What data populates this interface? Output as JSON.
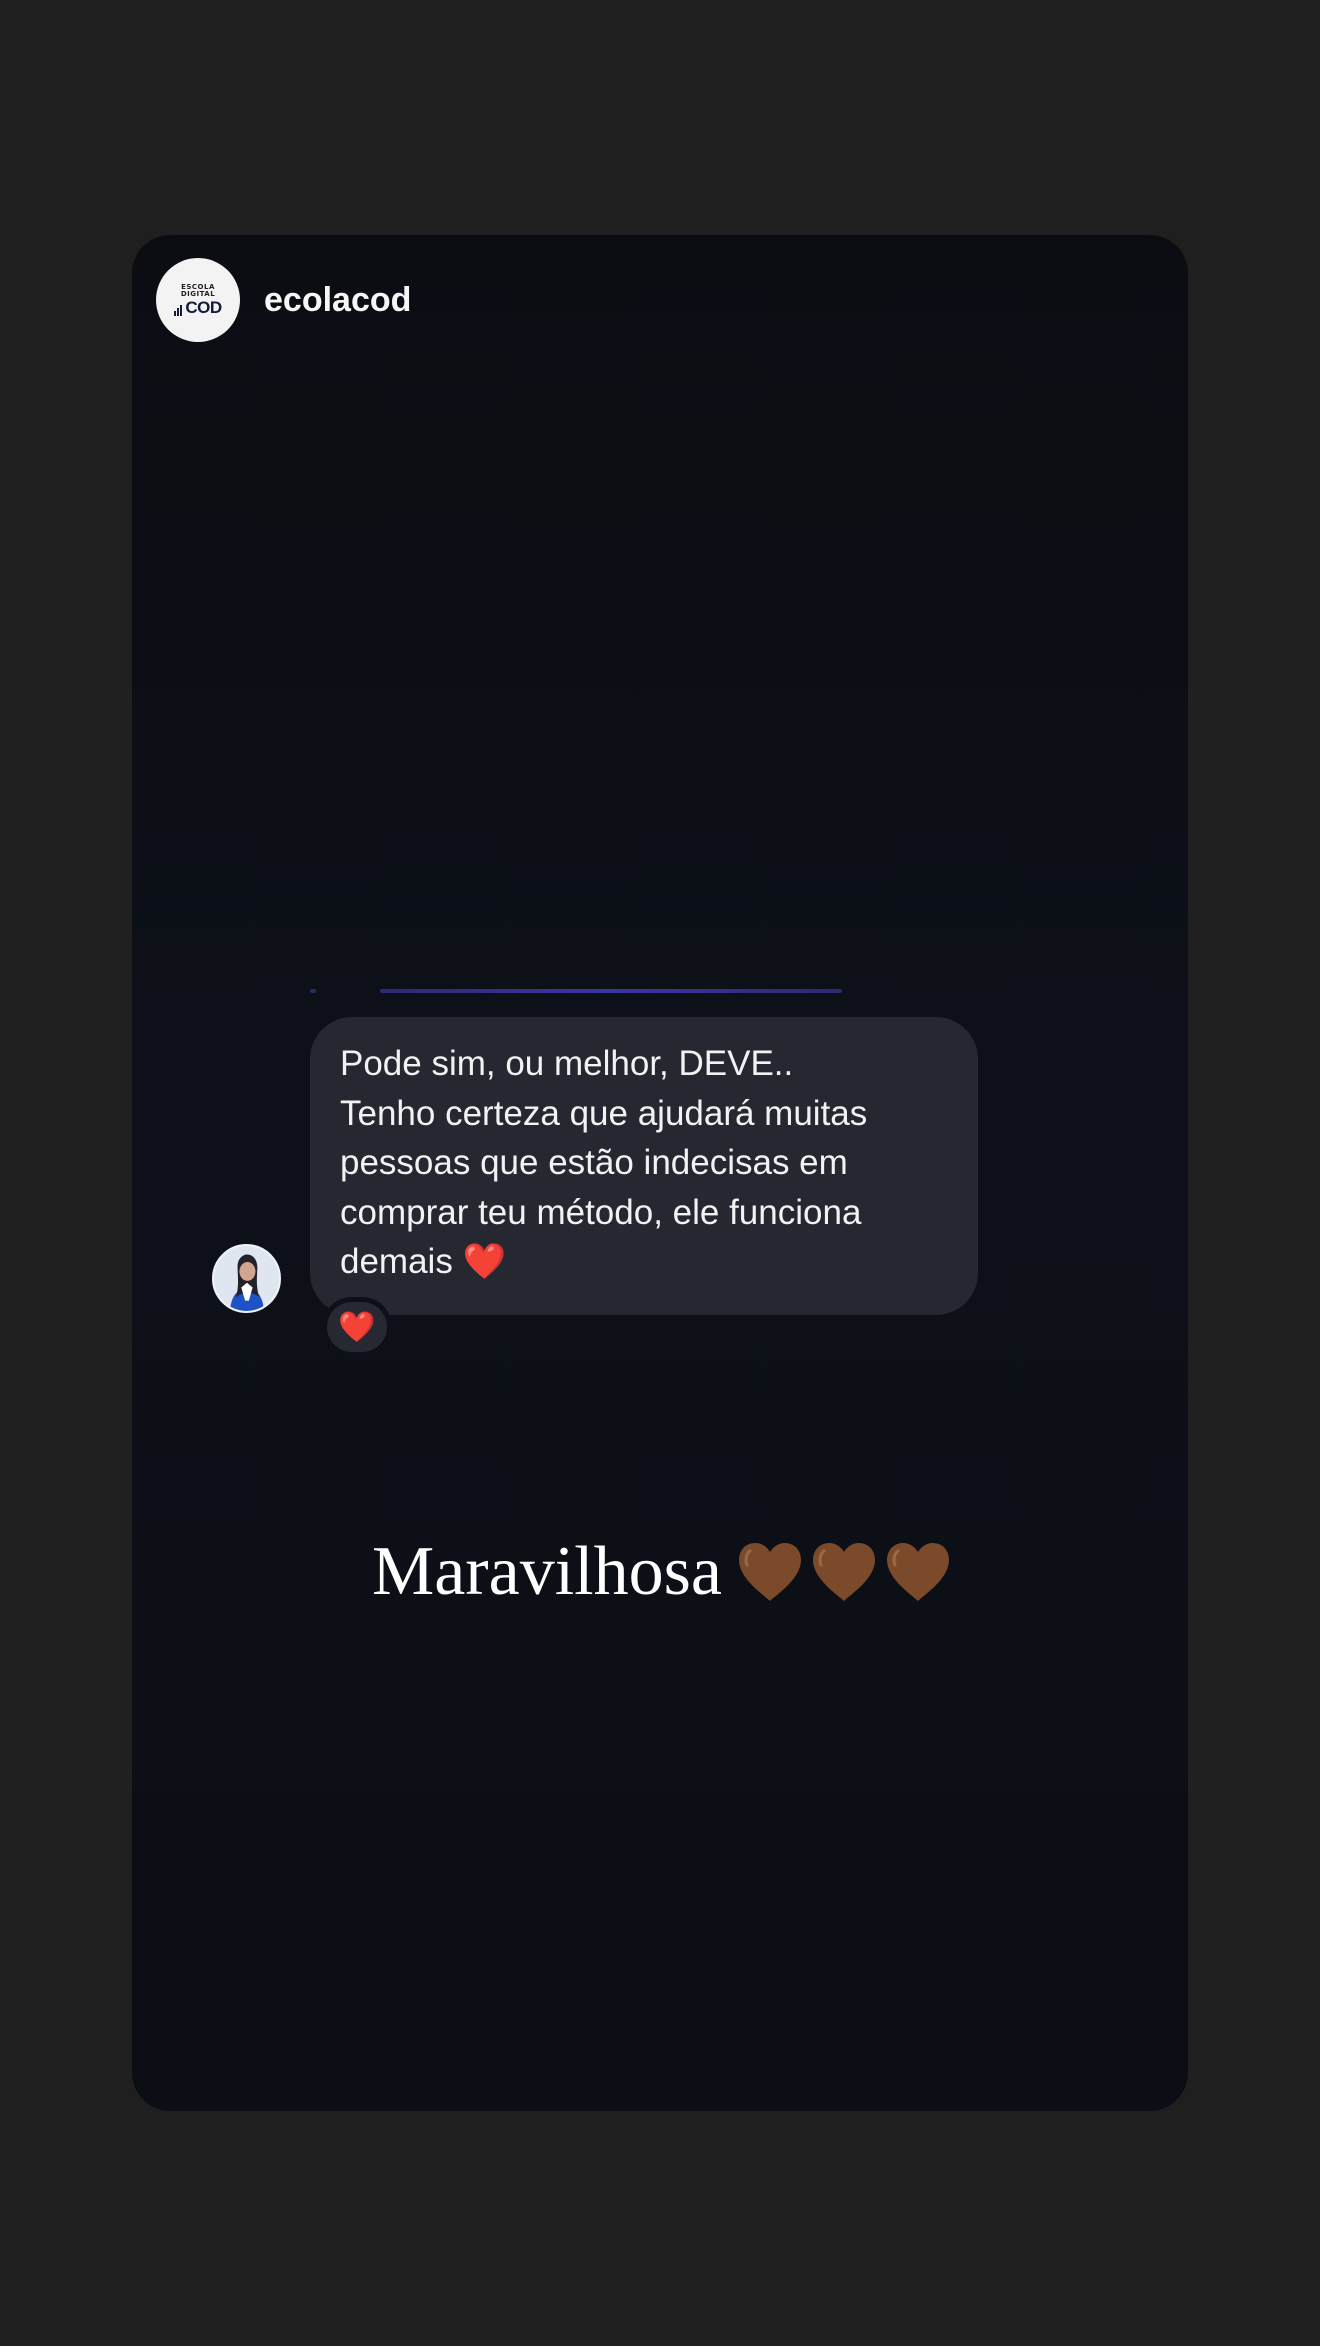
{
  "story": {
    "username": "ecolacod",
    "brand_avatar": {
      "small_line_1": "ESCOLA",
      "small_line_2": "DIGITAL",
      "logo_text": "COD"
    },
    "dm_avatar_icon": "profile-photo-icon",
    "message_text": "Pode sim, ou melhor, DEVE..\nTenho certeza que ajudará muitas pessoas que estão indecisas em comprar teu método, ele funciona demais ❤️",
    "reaction": "❤️",
    "caption_text": "Maravilhosa",
    "caption_icons": [
      "brown-heart-icon",
      "brown-heart-icon",
      "brown-heart-icon"
    ]
  },
  "colors": {
    "page_background": "#1f1f1f",
    "card_background": "#0d1018",
    "bubble_background": "#252831",
    "accent_indicator": "#3d38a8",
    "heart_brown": "#7a4a2a"
  }
}
